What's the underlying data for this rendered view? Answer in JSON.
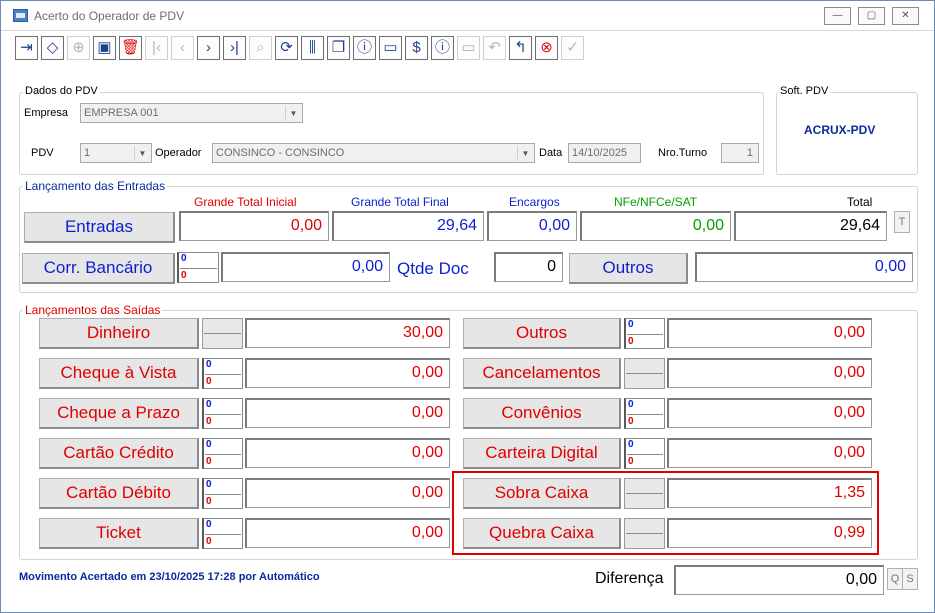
{
  "window": {
    "title": "Acerto do Operador de PDV"
  },
  "titlebar_buttons": {
    "minimize": "—",
    "maximize": "▢",
    "close": "✕"
  },
  "toolbar": [
    {
      "name": "exit-icon",
      "glyph": "⇥",
      "enabled": true
    },
    {
      "name": "eraser-icon",
      "glyph": "◇",
      "enabled": true
    },
    {
      "name": "add-icon",
      "glyph": "⊕",
      "enabled": false
    },
    {
      "name": "save-icon",
      "glyph": "▣",
      "enabled": true
    },
    {
      "name": "delete-icon",
      "glyph": "🗑",
      "enabled": true,
      "red": true
    },
    {
      "name": "first-icon",
      "glyph": "|‹",
      "enabled": false
    },
    {
      "name": "prev-icon",
      "glyph": "‹",
      "enabled": false
    },
    {
      "name": "next-icon",
      "glyph": "›",
      "enabled": true
    },
    {
      "name": "last-icon",
      "glyph": "›|",
      "enabled": true
    },
    {
      "name": "search-icon",
      "glyph": "⌕",
      "enabled": false
    },
    {
      "name": "refresh-icon",
      "glyph": "⟳",
      "enabled": true
    },
    {
      "name": "filter-icon",
      "glyph": "⫼",
      "enabled": true
    },
    {
      "name": "copy-icon",
      "glyph": "❐",
      "enabled": true
    },
    {
      "name": "info-icon",
      "glyph": "ⓘ",
      "enabled": true
    },
    {
      "name": "card-icon",
      "glyph": "▭",
      "enabled": true
    },
    {
      "name": "money-icon",
      "glyph": "$",
      "enabled": true
    },
    {
      "name": "info2-icon",
      "glyph": "ⓘ",
      "enabled": true
    },
    {
      "name": "card-disabled-icon",
      "glyph": "▭",
      "enabled": false
    },
    {
      "name": "undo-icon",
      "glyph": "↶",
      "enabled": false
    },
    {
      "name": "back-icon",
      "glyph": "↰",
      "enabled": true
    },
    {
      "name": "cancel-icon",
      "glyph": "⊗",
      "enabled": true,
      "red": true
    },
    {
      "name": "confirm-icon",
      "glyph": "✓",
      "enabled": false
    }
  ],
  "dados": {
    "group_label": "Dados do PDV",
    "empresa_label": "Empresa",
    "empresa_value": "EMPRESA 001",
    "pdv_label": "PDV",
    "pdv_value": "1",
    "operador_label": "Operador",
    "operador_value": "CONSINCO - CONSINCO",
    "data_label": "Data",
    "data_value": "14/10/2025",
    "turno_label": "Nro.Turno",
    "turno_value": "1"
  },
  "soft": {
    "group_label": "Soft. PDV",
    "value": "ACRUX-PDV"
  },
  "entradas": {
    "group_label": "Lançamento das Entradas",
    "headers": {
      "gti": "Grande Total Inicial",
      "gtf": "Grande Total Final",
      "encargos": "Encargos",
      "nfe": "NFe/NFCe/SAT",
      "total": "Total"
    },
    "entradas_button": "Entradas",
    "gti_value": "0,00",
    "gtf_value": "29,64",
    "encargos_value": "0,00",
    "nfe_value": "0,00",
    "total_value": "29,64",
    "t_button": "T",
    "corr_button": "Corr. Bancário",
    "corr_top": "0",
    "corr_bottom": "0",
    "corr_value": "0,00",
    "qtde_label": "Qtde Doc",
    "qtde_value": "0",
    "outros_button": "Outros",
    "outros_value": "0,00"
  },
  "saidas": {
    "group_label": "Lançamentos das Saídas",
    "left": [
      {
        "label": "Dinheiro",
        "mini": false,
        "value": "30,00",
        "color": "red"
      },
      {
        "label": "Cheque à Vista",
        "mini": true,
        "top": "0",
        "bottom": "0",
        "value": "0,00",
        "color": "red"
      },
      {
        "label": "Cheque a Prazo",
        "mini": true,
        "top": "0",
        "bottom": "0",
        "value": "0,00",
        "color": "red"
      },
      {
        "label": "Cartão Crédito",
        "mini": true,
        "top": "0",
        "bottom": "0",
        "value": "0,00",
        "color": "red"
      },
      {
        "label": "Cartão Débito",
        "mini": true,
        "top": "0",
        "bottom": "0",
        "value": "0,00",
        "color": "red"
      },
      {
        "label": "Ticket",
        "mini": true,
        "top": "0",
        "bottom": "0",
        "value": "0,00",
        "color": "red"
      }
    ],
    "right": [
      {
        "label": "Outros",
        "mini": true,
        "top": "0",
        "bottom": "0",
        "value": "0,00",
        "color": "red"
      },
      {
        "label": "Cancelamentos",
        "mini": false,
        "value": "0,00",
        "color": "red"
      },
      {
        "label": "Convênios",
        "mini": true,
        "top": "0",
        "bottom": "0",
        "value": "0,00",
        "color": "red"
      },
      {
        "label": "Carteira Digital",
        "mini": true,
        "top": "0",
        "bottom": "0",
        "value": "0,00",
        "color": "red"
      },
      {
        "label": "Sobra Caixa",
        "mini": false,
        "value": "1,35",
        "color": "red"
      },
      {
        "label": "Quebra Caixa",
        "mini": false,
        "value": "0,99",
        "color": "red"
      }
    ]
  },
  "footer": {
    "status": "Movimento Acertado em 23/10/2025 17:28 por Automático",
    "diferenca_label": "Diferença",
    "diferenca_value": "0,00",
    "q_button": "Q",
    "s_button": "S"
  },
  "colors": {
    "accent_blue": "#0c1fd0",
    "value_red": "#e00000",
    "green": "#00a000",
    "highlight": "#e00000"
  }
}
